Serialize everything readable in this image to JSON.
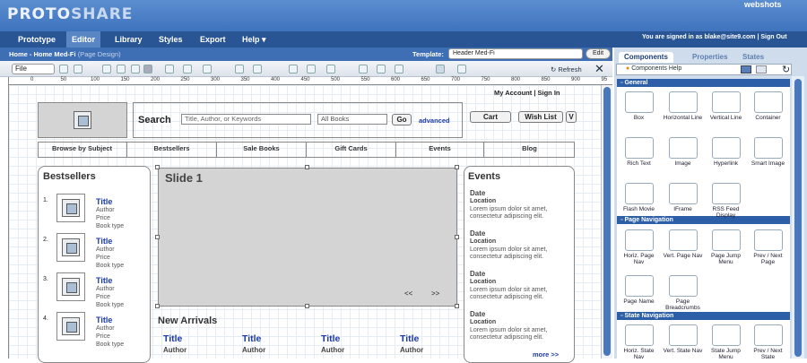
{
  "app": {
    "logo_part1": "PROTO",
    "logo_part2": "SHARE",
    "webshots": "webshots"
  },
  "menu": [
    {
      "label": "Prototype"
    },
    {
      "label": "Editor"
    },
    {
      "label": "Library"
    },
    {
      "label": "Styles"
    },
    {
      "label": "Export"
    },
    {
      "label": "Help ▾"
    }
  ],
  "signed_in": "You are signed in as blake@site9.com | Sign Out",
  "breadcrumb": {
    "path": "Home - Home Med-Fi",
    "suffix": "(Page Design)"
  },
  "template": {
    "label": "Template:",
    "value": "Header Med-Fi",
    "edit": "Edit"
  },
  "toolbar": {
    "file": "File",
    "refresh": "Refresh",
    "close": "✕"
  },
  "ruler_ticks": [
    "0",
    "50",
    "100",
    "150",
    "200",
    "250",
    "300",
    "350",
    "400",
    "450",
    "500",
    "550",
    "600",
    "650",
    "700",
    "750",
    "800",
    "850",
    "900",
    "95"
  ],
  "page": {
    "account": "My Account",
    "signin": "Sign In",
    "search_label": "Search",
    "search_placeholder": "Title, Author, or Keywords",
    "all_books": "All Books",
    "go": "Go",
    "advanced": "advanced",
    "cart": "Cart",
    "wishlist": "Wish List",
    "v": "V",
    "nav": [
      "Browse by Subject",
      "Bestsellers",
      "Sale Books",
      "Gift Cards",
      "Events",
      "Blog"
    ],
    "bestsellers_title": "Bestsellers",
    "bestsellers": [
      {
        "num": "1.",
        "title": "Title",
        "author": "Author",
        "price": "Price",
        "type": "Book type"
      },
      {
        "num": "2.",
        "title": "Title",
        "author": "Author",
        "price": "Price",
        "type": "Book type"
      },
      {
        "num": "3.",
        "title": "Title",
        "author": "Author",
        "price": "Price",
        "type": "Book type"
      },
      {
        "num": "4.",
        "title": "Title",
        "author": "Author",
        "price": "Price",
        "type": "Book type"
      }
    ],
    "slide_title": "Slide 1",
    "slide_prev": "<<",
    "slide_next": ">>",
    "new_arrivals": "New Arrivals",
    "arrivals": [
      {
        "title": "Title",
        "author": "Author"
      },
      {
        "title": "Title",
        "author": "Author"
      },
      {
        "title": "Title",
        "author": "Author"
      },
      {
        "title": "Title",
        "author": "Author"
      }
    ],
    "events_title": "Events",
    "events": [
      {
        "date": "Date",
        "location": "Location",
        "text": "Lorem ipsum dolor sit amet, consectetur adipiscing elit."
      },
      {
        "date": "Date",
        "location": "Location",
        "text": "Lorem ipsum dolor sit amet, consectetur adipiscing elit."
      },
      {
        "date": "Date",
        "location": "Location",
        "text": "Lorem ipsum dolor sit amet, consectetur adipiscing elit."
      },
      {
        "date": "Date",
        "location": "Location",
        "text": "Lorem ipsum dolor sit amet, consectetur adipiscing elit."
      }
    ],
    "more": "more >>"
  },
  "panel": {
    "tabs": [
      "Components",
      "Properties",
      "States"
    ],
    "help": "Components Help",
    "sections": {
      "general": "General",
      "page_nav": "Page Navigation",
      "state_nav": "State Navigation"
    },
    "general_items": [
      "Box",
      "Horizontal Line",
      "Vertical Line",
      "Container",
      "Rich Text",
      "Image",
      "Hyperlink",
      "Smart Image",
      "Flash Movie",
      "IFrame",
      "RSS Feed Display"
    ],
    "page_nav_items": [
      "Horiz. Page Nav",
      "Vert. Page Nav",
      "Page Jump Menu",
      "Prev / Next Page",
      "Page Name",
      "Page Breadcrumbs"
    ],
    "state_nav_items": [
      "Horiz. State Nav",
      "Vert. State Nav",
      "State Jump Menu",
      "Prev / Next State"
    ]
  }
}
